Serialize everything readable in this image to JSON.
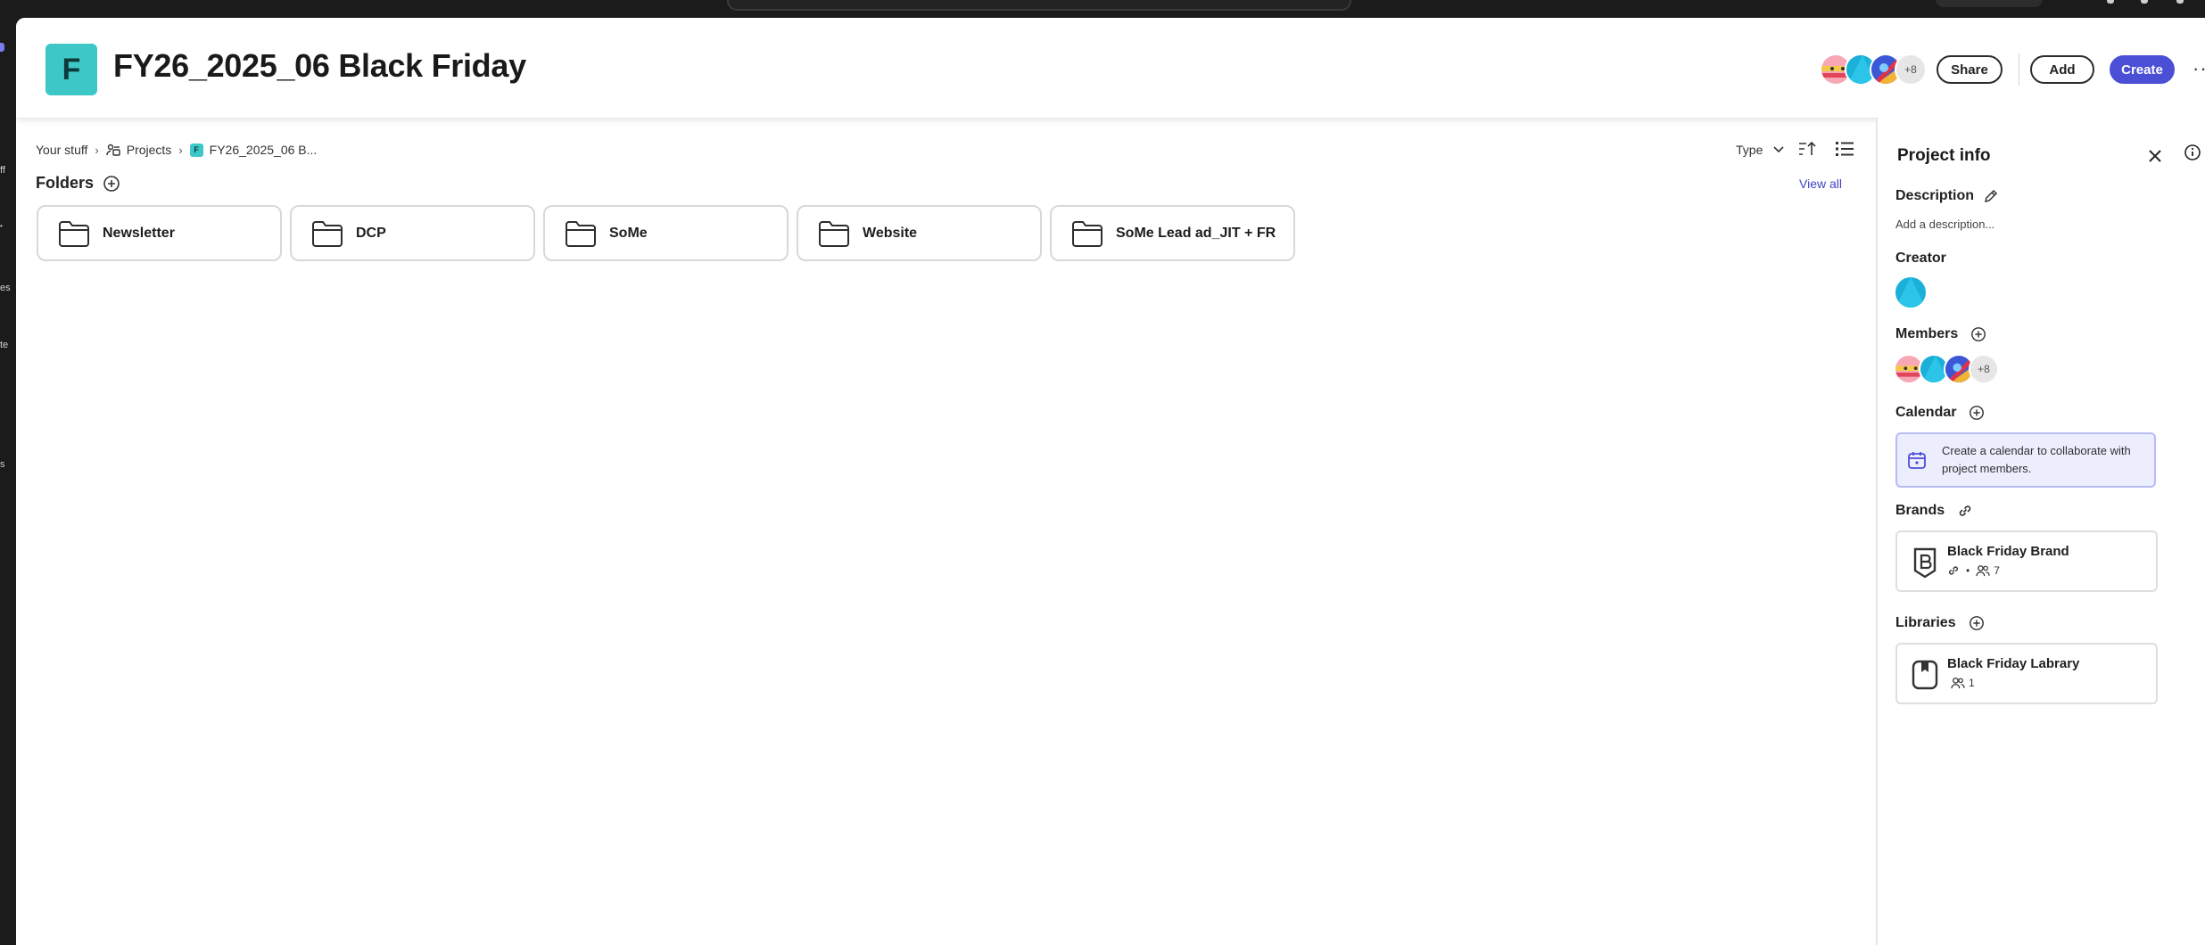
{
  "project": {
    "initial": "F",
    "title": "FY26_2025_06 Black Friday"
  },
  "header": {
    "members_more": "+8",
    "share_label": "Share",
    "add_label": "Add",
    "create_label": "Create",
    "more_label": "···"
  },
  "rail": {
    "fragments": [
      "ff",
      "es",
      "te",
      "s"
    ]
  },
  "breadcrumb": {
    "root": "Your stuff",
    "projects": "Projects",
    "current": "FY26_2025_06 B..."
  },
  "toolbar": {
    "type_filter": "Type"
  },
  "folders": {
    "title": "Folders",
    "view_all": "View all",
    "items": [
      {
        "label": "Newsletter"
      },
      {
        "label": "DCP"
      },
      {
        "label": "SoMe"
      },
      {
        "label": "Website"
      },
      {
        "label": "SoMe Lead ad_JIT + FR"
      }
    ]
  },
  "panel": {
    "title": "Project info",
    "description_label": "Description",
    "description_placeholder": "Add a description...",
    "creator_label": "Creator",
    "members_label": "Members",
    "members_more": "+8",
    "calendar_label": "Calendar",
    "calendar_text": "Create a calendar to collaborate with project members.",
    "brands_label": "Brands",
    "brand": {
      "name": "Black Friday Brand",
      "members": "7",
      "separator": "•"
    },
    "libraries_label": "Libraries",
    "library": {
      "name": "Black Friday Labrary",
      "members": "1"
    }
  },
  "colors": {
    "accent": "#4b4fd6",
    "project_tile": "#3ec7c7",
    "link": "#3f44c7",
    "calendar_bg": "#eceefe"
  }
}
